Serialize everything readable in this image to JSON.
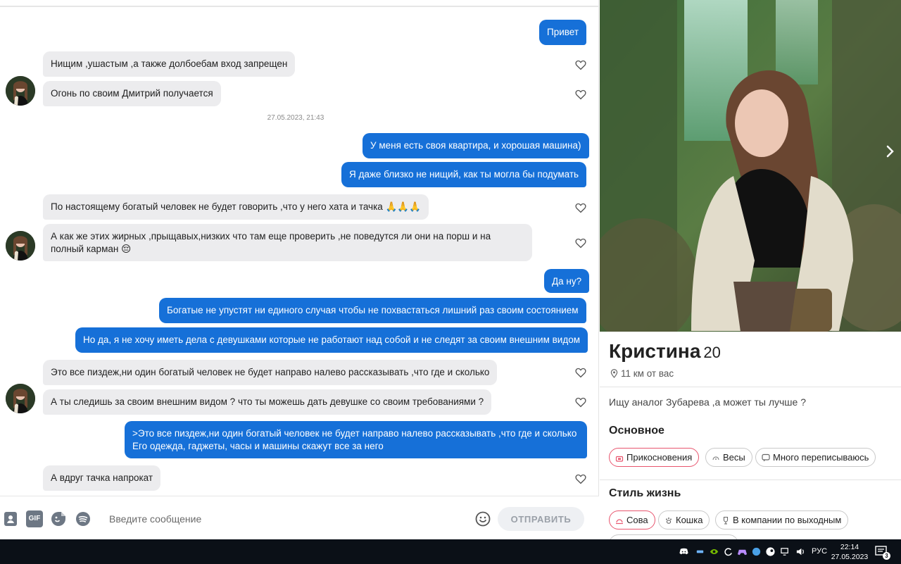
{
  "chat": {
    "messages": [
      {
        "text": "Привет"
      },
      {
        "text": "Нищим ,ушастым ,а также долбоебам вход запрещен"
      },
      {
        "text": "Огонь по своим Дмитрий получается"
      },
      {
        "text": "У меня есть своя квартира, и хорошая машина)"
      },
      {
        "text": "Я даже близко не нищий, как ты могла бы подумать"
      },
      {
        "text": "По настоящему богатый человек не будет говорить ,что у него хата и тачка 🙏🙏🙏"
      },
      {
        "text": "А как же этих жирных ,прыщавых,низких что там еще проверить ,не поведутся ли они на порш и на полный карман 😔"
      },
      {
        "text": "Да ну?"
      },
      {
        "text": "Богатые не упустят ни единого случая чтобы не похвастаться лишний раз своим состоянием"
      },
      {
        "text": "Но да, я не хочу иметь дела с девушками которые не работают над собой и не следят за своим внешним видом"
      },
      {
        "text": "Это все пиздеж,ни один богатый человек не будет направо налево рассказывать ,что где и сколько"
      },
      {
        "text": "А ты следишь за своим внешним видом ? что ты можешь дать девушке со своим требованиями ?"
      },
      {
        "text": ">Это все пиздеж,ни один богатый человек не будет направо налево рассказывать ,что где и сколько Его одежда, гаджеты, часы и машины скажут все за него"
      },
      {
        "text": "А вдруг тачка напрокат"
      }
    ],
    "date_separator": "27.05.2023, 21:43",
    "composer": {
      "placeholder": "Введите сообщение",
      "send_label": "ОТПРАВИТЬ",
      "gif_label": "GIF"
    }
  },
  "profile": {
    "name": "Кристина",
    "age": "20",
    "distance": "11 км от вас",
    "bio": "Ищу аналог Зубарева ,а может ты лучше ?",
    "sections": [
      {
        "title": "Основное",
        "chips": [
          "Прикосновения",
          "Весы",
          "Много переписываюсь"
        ]
      },
      {
        "title": "Стиль жизнь",
        "chips": [
          "Сова",
          "Кошка",
          "В компании по выходным"
        ]
      }
    ]
  },
  "taskbar": {
    "language": "РУС",
    "time": "22:14",
    "date": "27.05.2023",
    "notification_count": "3"
  },
  "colors": {
    "outgoing_bubble": "#1670d8",
    "incoming_bubble": "#ececee",
    "chip_selected_border": "#e8556e",
    "taskbar": "#0b1017"
  }
}
